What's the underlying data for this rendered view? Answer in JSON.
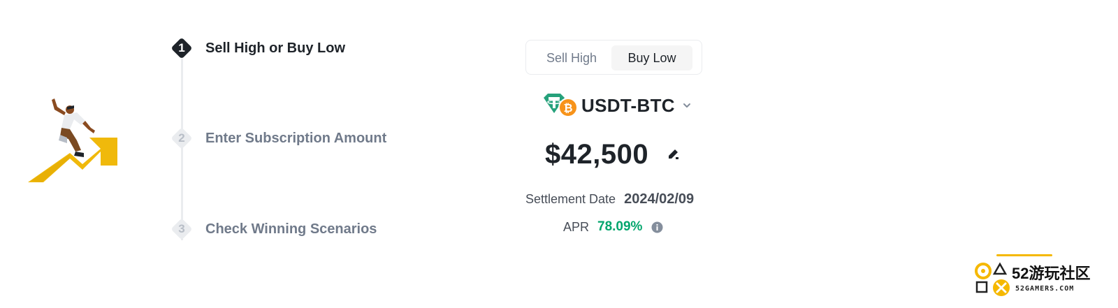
{
  "steps": [
    {
      "number": "1",
      "label": "Sell High or Buy Low",
      "active": true
    },
    {
      "number": "2",
      "label": "Enter Subscription Amount",
      "active": false
    },
    {
      "number": "3",
      "label": "Check Winning Scenarios",
      "active": false
    }
  ],
  "toggle": {
    "sell_label": "Sell High",
    "buy_label": "Buy Low",
    "selected": "Buy Low"
  },
  "pair": {
    "name": "USDT-BTC",
    "icons": [
      "tether-icon",
      "bitcoin-icon"
    ]
  },
  "amount": {
    "value": "$42,500",
    "icon": "edit-pencil-icon"
  },
  "settlement": {
    "label": "Settlement Date",
    "value": "2024/02/09"
  },
  "apr": {
    "label": "APR",
    "value": "78.09%",
    "icon": "info-icon"
  },
  "watermark": {
    "title": "52游玩社区",
    "subtitle": "52GAMERS.COM"
  },
  "colors": {
    "accent_yellow": "#F0B90B",
    "positive_green": "#03A66D",
    "text_dark": "#1E2329",
    "text_muted": "#707A8A"
  }
}
